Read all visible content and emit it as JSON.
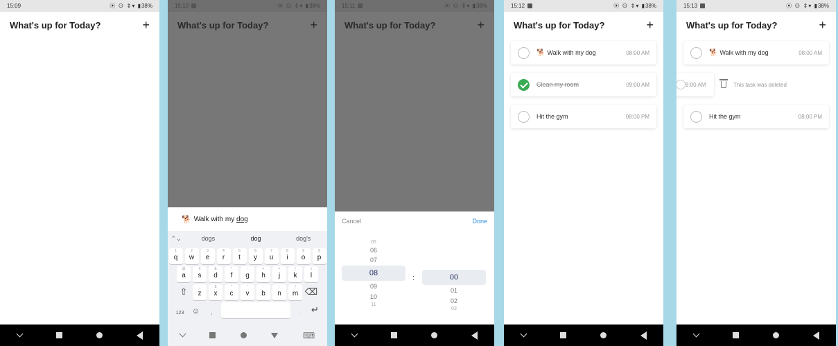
{
  "app": {
    "title": "What's up for Today?",
    "add_icon": "+"
  },
  "status": {
    "battery": "38%",
    "icons": "⦿ ⊖ ⇕▾ ▮"
  },
  "screens": [
    {
      "time": "15:09"
    },
    {
      "time": "15:10"
    },
    {
      "time": "15:11"
    },
    {
      "time": "15:12"
    },
    {
      "time": "15:13"
    }
  ],
  "input": {
    "value_prefix": "Walk with my ",
    "value_underlined": "dog",
    "emoji": "🐕"
  },
  "keyboard": {
    "suggestions": [
      "dogs",
      "dog",
      "dog's"
    ],
    "row1": [
      {
        "k": "q",
        "s": "1"
      },
      {
        "k": "w",
        "s": "2"
      },
      {
        "k": "e",
        "s": "3"
      },
      {
        "k": "r",
        "s": "4"
      },
      {
        "k": "t",
        "s": "5"
      },
      {
        "k": "y",
        "s": "6"
      },
      {
        "k": "u",
        "s": "7"
      },
      {
        "k": "i",
        "s": "8"
      },
      {
        "k": "o",
        "s": "9"
      },
      {
        "k": "p",
        "s": "0"
      }
    ],
    "row2": [
      {
        "k": "a",
        "s": "@"
      },
      {
        "k": "s",
        "s": "#"
      },
      {
        "k": "d",
        "s": "&"
      },
      {
        "k": "f",
        "s": "*"
      },
      {
        "k": "g",
        "s": "-"
      },
      {
        "k": "h",
        "s": "+"
      },
      {
        "k": "j",
        "s": "="
      },
      {
        "k": "k",
        "s": "("
      },
      {
        "k": "l",
        "s": ")"
      }
    ],
    "row3": [
      {
        "k": "z",
        "s": "_"
      },
      {
        "k": "x",
        "s": "$"
      },
      {
        "k": "c",
        "s": "\""
      },
      {
        "k": "v",
        "s": "'"
      },
      {
        "k": "b",
        "s": ":"
      },
      {
        "k": "n",
        "s": ";"
      },
      {
        "k": "m",
        "s": "/"
      }
    ],
    "sym_label": "123"
  },
  "picker": {
    "cancel": "Cancel",
    "done": "Done",
    "hours": {
      "far_top": "05",
      "above": [
        "06",
        "07"
      ],
      "selected": "08",
      "below": [
        "09",
        "10"
      ],
      "far_bottom": "11"
    },
    "minutes": {
      "selected": "00",
      "below": [
        "01",
        "02"
      ],
      "far_bottom": "03"
    },
    "colon": ":"
  },
  "tasks_s4": [
    {
      "text": "Walk with my dog",
      "time": "08:00 AM",
      "done": false,
      "emoji": true
    },
    {
      "text": "Clean my room",
      "time": "09:00 AM",
      "done": true,
      "emoji": false
    },
    {
      "text": "Hit the gym",
      "time": "08:00 PM",
      "done": false,
      "emoji": false
    }
  ],
  "tasks_s5": {
    "first": {
      "text": "Walk with my dog",
      "time": "08:00 AM"
    },
    "swiped_time": "9:00 AM",
    "deleted_msg": "This task was deleted",
    "third": {
      "text": "Hit the gym",
      "time": "08:00 PM"
    }
  }
}
